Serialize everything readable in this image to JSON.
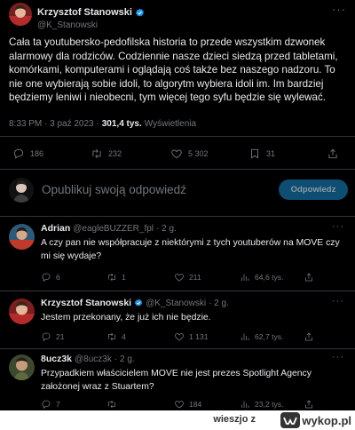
{
  "tweet": {
    "author_name": "Krzysztof Stanowski",
    "author_handle": "@K_Stanowski",
    "text": "Cała ta youtubersko-pedofilska historia to przede wszystkim dzwonek alarmowy dla rodziców. Codziennie nasze dzieci siedzą przed tabletami, komórkami, komputerami i oglądają coś także bez naszego nadzoru. To nie one wybierają sobie idoli, to algorytm wybiera idoli im. Im bardziej będziemy leniwi i nieobecni, tym więcej tego syfu będzie się wylewać.",
    "time": "8:33 PM · 3 paź 2023 ·",
    "views_count": "301,4 tys.",
    "views_label": "Wyświetlenia",
    "stats": {
      "replies": "186",
      "retweets": "232",
      "likes": "5 302",
      "bookmarks": "31"
    }
  },
  "reply_box": {
    "placeholder": "Opublikuj swoją odpowiedź",
    "button": "Odpowiedz"
  },
  "replies": [
    {
      "name": "Adrian",
      "handle": "@eagleBUZZER_fpl",
      "time": "· 2 g.",
      "text": "A czy pan nie współpracuje z niektórymi z tych youtuberów na MOVE czy mi się wydaje?",
      "replies": "6",
      "retweets": "1",
      "likes": "211",
      "views": "64,6 tys."
    },
    {
      "name": "Krzysztof Stanowski",
      "handle": "@K_Stanowski",
      "time": "· 2 g.",
      "text": "Jestem przekonany, że już ich nie będzie.",
      "replies": "21",
      "retweets": "4",
      "likes": "1 131",
      "views": "62,7 tys."
    },
    {
      "name": "8ucz3k",
      "handle": "@8ucz3k",
      "time": "· 2 g.",
      "text": "Przypadkiem właścicielem MOVE nie jest prezes Spotlight Agency założonej wraz z Stuartem?",
      "replies": "7",
      "retweets": "",
      "likes": "184",
      "views": "23,2 tys."
    }
  ],
  "footer": {
    "uploader": "wieszjo",
    "separator": "z",
    "site": "wykop.pl"
  },
  "colors": {
    "verified": "#1d9bf0",
    "background": "#000000",
    "muted": "#71767b",
    "reply_button_bg": "#0f4e73"
  },
  "icons": [
    "verified-badge-icon",
    "more-icon",
    "reply-icon",
    "retweet-icon",
    "like-icon",
    "views-icon",
    "bookmark-icon",
    "share-icon",
    "wykop-logo-icon"
  ]
}
